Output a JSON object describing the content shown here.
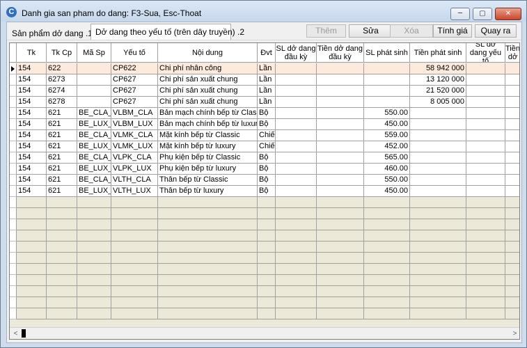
{
  "window": {
    "title": "Danh gia san pham do dang: F3-Sua, Esc-Thoat",
    "app_icon": "C",
    "controls": {
      "minimize": "─",
      "maximize": "▢",
      "close": "✕"
    }
  },
  "tabs": [
    {
      "label": "Sản phẩm dở dang .1"
    },
    {
      "label": "Dở dang theo yếu tố (trên dây truyền) .2"
    }
  ],
  "toolbar": {
    "them": "Thêm",
    "sua": "Sửa",
    "xoa": "Xóa",
    "tinh_gia": "Tính giá",
    "quay_ra": "Quay ra"
  },
  "table": {
    "headers": {
      "tk": "Tk",
      "tk_cp": "Tk Cp",
      "ma_sp": "Mã Sp",
      "yeu_to": "Yếu tố",
      "noi_dung": "Nội dung",
      "dvt": "Đvt",
      "sl_do_dang_dau_ky": "SL dở dang đầu kỳ",
      "tien_do_dang_dau_ky": "Tiền dở dang đầu kỳ",
      "sl_phat_sinh": "SL phát sinh",
      "tien_phat_sinh": "Tiền phát sinh",
      "sl_do_dang_yeu_to": "SL dở dang yếu tố",
      "tien_do": "Tiền dở"
    },
    "rows": [
      {
        "tk": "154",
        "tk_cp": "622",
        "ma_sp": "",
        "yeu_to": "CP622",
        "noi_dung": "Chi phí nhân công",
        "dvt": "Lần",
        "sl_ddk": "",
        "tien_ddk": "",
        "sl_ps": "",
        "tien_ps": "58 942 000",
        "sl_yt": ""
      },
      {
        "tk": "154",
        "tk_cp": "6273",
        "ma_sp": "",
        "yeu_to": "CP627",
        "noi_dung": "Chi phí sản xuất chung",
        "dvt": "Lần",
        "sl_ddk": "",
        "tien_ddk": "",
        "sl_ps": "",
        "tien_ps": "13 120 000",
        "sl_yt": ""
      },
      {
        "tk": "154",
        "tk_cp": "6274",
        "ma_sp": "",
        "yeu_to": "CP627",
        "noi_dung": "Chi phí sản xuất chung",
        "dvt": "Lần",
        "sl_ddk": "",
        "tien_ddk": "",
        "sl_ps": "",
        "tien_ps": "21 520 000",
        "sl_yt": ""
      },
      {
        "tk": "154",
        "tk_cp": "6278",
        "ma_sp": "",
        "yeu_to": "CP627",
        "noi_dung": "Chi phí sản xuất chung",
        "dvt": "Lần",
        "sl_ddk": "",
        "tien_ddk": "",
        "sl_ps": "",
        "tien_ps": "8 005 000",
        "sl_yt": ""
      },
      {
        "tk": "154",
        "tk_cp": "621",
        "ma_sp": "BE_CLA_",
        "yeu_to": "VLBM_CLA",
        "noi_dung": "Bản mạch chính bếp từ Classic",
        "dvt": "Bộ",
        "sl_ddk": "",
        "tien_ddk": "",
        "sl_ps": "550.00",
        "tien_ps": "",
        "sl_yt": ""
      },
      {
        "tk": "154",
        "tk_cp": "621",
        "ma_sp": "BE_LUX_",
        "yeu_to": "VLBM_LUX",
        "noi_dung": "Bản mạch chính bếp từ luxury",
        "dvt": "Bộ",
        "sl_ddk": "",
        "tien_ddk": "",
        "sl_ps": "450.00",
        "tien_ps": "",
        "sl_yt": ""
      },
      {
        "tk": "154",
        "tk_cp": "621",
        "ma_sp": "BE_CLA_",
        "yeu_to": "VLMK_CLA",
        "noi_dung": "Mặt kính bếp từ Classic",
        "dvt": "Chiếc",
        "sl_ddk": "",
        "tien_ddk": "",
        "sl_ps": "559.00",
        "tien_ps": "",
        "sl_yt": ""
      },
      {
        "tk": "154",
        "tk_cp": "621",
        "ma_sp": "BE_LUX_",
        "yeu_to": "VLMK_LUX",
        "noi_dung": "Mặt kính bếp từ luxury",
        "dvt": "Chiếc",
        "sl_ddk": "",
        "tien_ddk": "",
        "sl_ps": "452.00",
        "tien_ps": "",
        "sl_yt": ""
      },
      {
        "tk": "154",
        "tk_cp": "621",
        "ma_sp": "BE_CLA_",
        "yeu_to": "VLPK_CLA",
        "noi_dung": "Phụ kiện bếp từ Classic",
        "dvt": "Bộ",
        "sl_ddk": "",
        "tien_ddk": "",
        "sl_ps": "565.00",
        "tien_ps": "",
        "sl_yt": ""
      },
      {
        "tk": "154",
        "tk_cp": "621",
        "ma_sp": "BE_LUX_",
        "yeu_to": "VLPK_LUX",
        "noi_dung": "Phụ kiện bếp từ luxury",
        "dvt": "Bộ",
        "sl_ddk": "",
        "tien_ddk": "",
        "sl_ps": "460.00",
        "tien_ps": "",
        "sl_yt": ""
      },
      {
        "tk": "154",
        "tk_cp": "621",
        "ma_sp": "BE_CLA_",
        "yeu_to": "VLTH_CLA",
        "noi_dung": "Thân bếp từ Classic",
        "dvt": "Bộ",
        "sl_ddk": "",
        "tien_ddk": "",
        "sl_ps": "550.00",
        "tien_ps": "",
        "sl_yt": ""
      },
      {
        "tk": "154",
        "tk_cp": "621",
        "ma_sp": "BE_LUX_",
        "yeu_to": "VLTH_LUX",
        "noi_dung": "Thân bếp từ luxury",
        "dvt": "Bộ",
        "sl_ddk": "",
        "tien_ddk": "",
        "sl_ps": "450.00",
        "tien_ps": "",
        "sl_yt": ""
      }
    ]
  },
  "scrollbar": {
    "left_arrow": "<",
    "right_arrow": ">"
  }
}
